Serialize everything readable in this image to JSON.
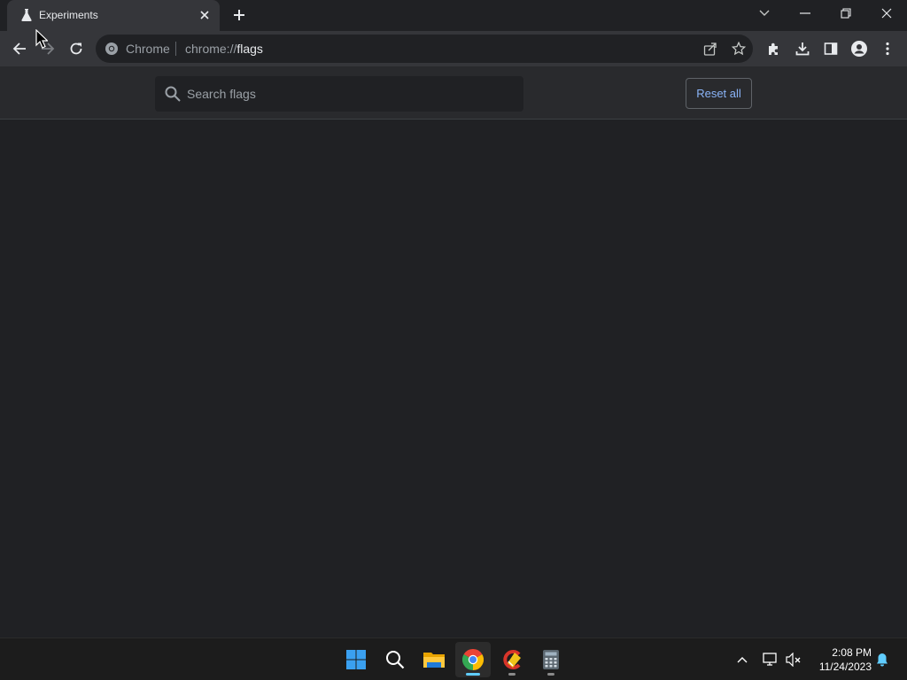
{
  "browser": {
    "tab": {
      "title": "Experiments"
    },
    "omnibox": {
      "chip": "Chrome",
      "url_scheme": "chrome://",
      "url_host": "flags"
    }
  },
  "flags_page": {
    "search": {
      "placeholder": "Search flags",
      "value": ""
    },
    "reset_label": "Reset all"
  },
  "taskbar": {
    "apps": [
      "start-icon",
      "search-icon",
      "file-explorer-icon",
      "chrome-icon",
      "ccleaner-icon",
      "calculator-icon"
    ],
    "active_app": "chrome-icon",
    "clock": {
      "time": "2:08 PM",
      "date": "11/24/2023"
    }
  },
  "colors": {
    "accent": "#8ab4f8",
    "background": "#202124",
    "toolbar": "#35363a"
  }
}
